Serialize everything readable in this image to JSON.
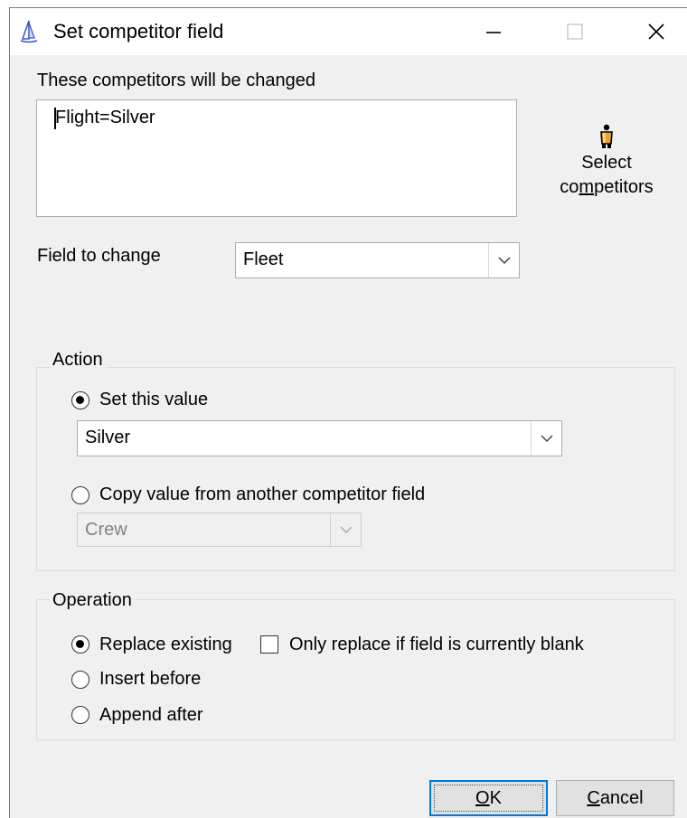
{
  "window": {
    "title": "Set competitor field",
    "minimize_icon": "minimize-icon",
    "maximize_icon": "maximize-icon",
    "close_icon": "close-icon"
  },
  "competitors": {
    "label": "These competitors will be changed",
    "list": [
      "Flight=Silver"
    ],
    "select_button": {
      "line1": "Select",
      "line2_pre": "co",
      "line2_mnemonic": "m",
      "line2_post": "petitors",
      "icon": "competitor-figure-icon"
    }
  },
  "field_to_change": {
    "label": "Field to change",
    "value": "Fleet"
  },
  "action": {
    "title": "Action",
    "set_value": {
      "label": "Set this value",
      "selected": true,
      "value": "Silver"
    },
    "copy_value": {
      "label": "Copy value from another competitor field",
      "selected": false,
      "value": "Crew"
    }
  },
  "operation": {
    "title": "Operation",
    "options": [
      {
        "label": "Replace existing",
        "selected": true
      },
      {
        "label": "Insert before",
        "selected": false
      },
      {
        "label": "Append after",
        "selected": false
      }
    ],
    "only_blank": {
      "label": "Only replace if field is currently blank",
      "checked": false
    }
  },
  "buttons": {
    "ok": {
      "mnemonic": "O",
      "rest": "K"
    },
    "cancel": {
      "mnemonic": "C",
      "rest": "ancel"
    }
  }
}
